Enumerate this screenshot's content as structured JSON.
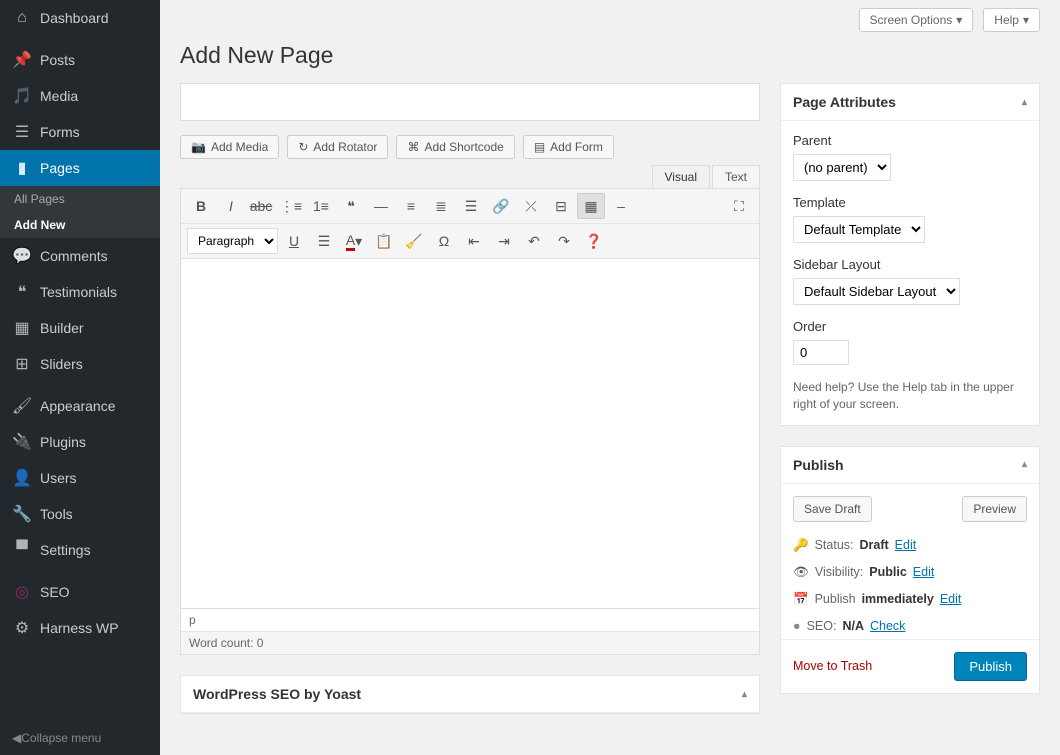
{
  "header": {
    "screen_options": "Screen Options",
    "help": "Help",
    "title": "Add New Page"
  },
  "sidebar": {
    "items": [
      {
        "label": "Dashboard",
        "icon": "dashboard"
      },
      {
        "label": "Posts",
        "icon": "pin"
      },
      {
        "label": "Media",
        "icon": "media"
      },
      {
        "label": "Forms",
        "icon": "forms"
      },
      {
        "label": "Pages",
        "icon": "pages",
        "active": true
      },
      {
        "label": "Comments",
        "icon": "comments"
      },
      {
        "label": "Testimonials",
        "icon": "quote"
      },
      {
        "label": "Builder",
        "icon": "builder"
      },
      {
        "label": "Sliders",
        "icon": "sliders"
      },
      {
        "label": "Appearance",
        "icon": "brush"
      },
      {
        "label": "Plugins",
        "icon": "plug"
      },
      {
        "label": "Users",
        "icon": "user"
      },
      {
        "label": "Tools",
        "icon": "wrench"
      },
      {
        "label": "Settings",
        "icon": "settings"
      },
      {
        "label": "SEO",
        "icon": "seo"
      },
      {
        "label": "Harness WP",
        "icon": "gear"
      }
    ],
    "submenu": [
      {
        "label": "All Pages"
      },
      {
        "label": "Add New",
        "active": true
      }
    ],
    "collapse": "Collapse menu"
  },
  "editor": {
    "add_media": "Add Media",
    "add_rotator": "Add Rotator",
    "add_shortcode": "Add Shortcode",
    "add_form": "Add Form",
    "tab_visual": "Visual",
    "tab_text": "Text",
    "format_select": "Paragraph",
    "path": "p",
    "word_count": "Word count: 0"
  },
  "attributes": {
    "title": "Page Attributes",
    "parent_label": "Parent",
    "parent_value": "(no parent)",
    "template_label": "Template",
    "template_value": "Default Template",
    "sidebar_label": "Sidebar Layout",
    "sidebar_value": "Default Sidebar Layout",
    "order_label": "Order",
    "order_value": "0",
    "help_text": "Need help? Use the Help tab in the upper right of your screen."
  },
  "publish": {
    "title": "Publish",
    "save_draft": "Save Draft",
    "preview": "Preview",
    "status_label": "Status:",
    "status_value": "Draft",
    "visibility_label": "Visibility:",
    "visibility_value": "Public",
    "publish_label": "Publish",
    "publish_value": "immediately",
    "seo_label": "SEO:",
    "seo_value": "N/A",
    "seo_check": "Check",
    "edit": "Edit",
    "move_to_trash": "Move to Trash",
    "publish_btn": "Publish"
  },
  "yoast": {
    "title": "WordPress SEO by Yoast"
  }
}
